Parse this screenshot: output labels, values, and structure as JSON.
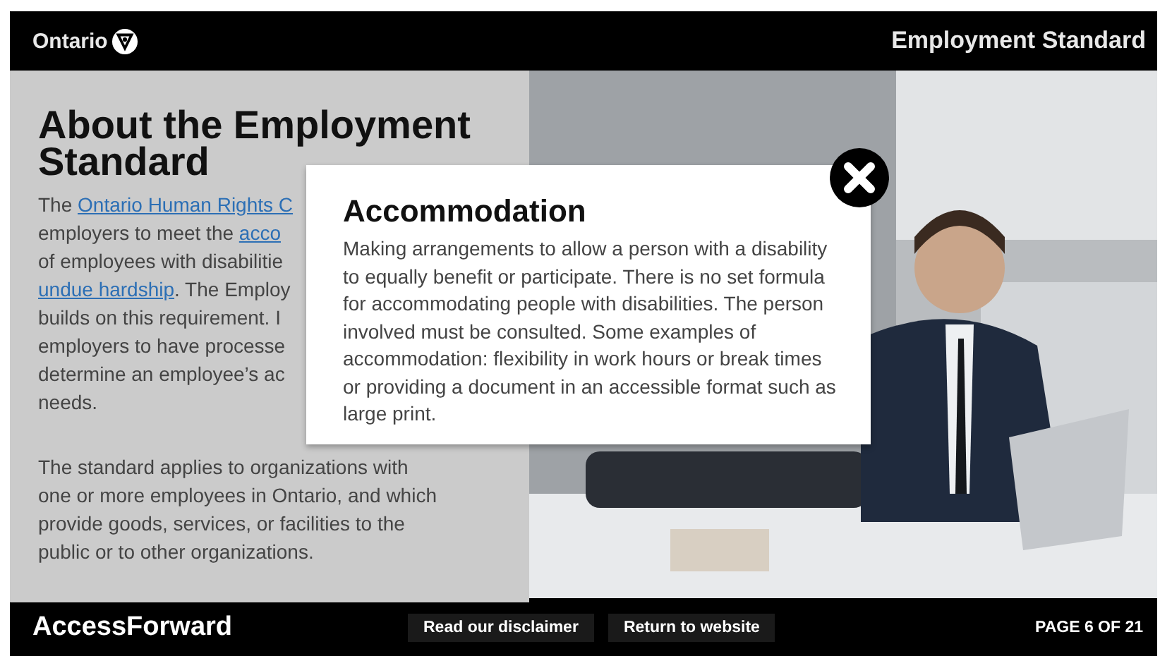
{
  "header": {
    "brand": "Ontario",
    "title": "Employment Standard"
  },
  "article": {
    "heading": "About the Employment Standard",
    "paragraphs": [
      [
        [
          {
            "text": "The ",
            "link": false
          },
          {
            "text": "Ontario Human Rights C",
            "link": true
          }
        ],
        [
          {
            "text": "employers to meet the ",
            "link": false
          },
          {
            "text": "acco",
            "link": true
          }
        ],
        [
          {
            "text": "of employees with disabilitie",
            "link": false
          }
        ],
        [
          {
            "text": "undue hardship",
            "link": true
          },
          {
            "text": ". The Employ",
            "link": false
          }
        ],
        [
          {
            "text": "builds on this requirement. I",
            "link": false
          }
        ],
        [
          {
            "text": "employers to have processe",
            "link": false
          }
        ],
        [
          {
            "text": "determine an employee’s ac",
            "link": false
          }
        ],
        [
          {
            "text": "needs.",
            "link": false
          }
        ]
      ],
      [
        [
          {
            "text": "The standard applies to organizations with",
            "link": false
          }
        ],
        [
          {
            "text": "one or more employees in Ontario, and which",
            "link": false
          }
        ],
        [
          {
            "text": "provide goods, services, or facilities to the",
            "link": false
          }
        ],
        [
          {
            "text": "public or to other organizations.",
            "link": false
          }
        ]
      ]
    ]
  },
  "modal": {
    "title": "Accommodation",
    "text": "Making arrangements to allow a person with a disability to equally benefit or participate. There is no set formula for accommodating people with disabilities. The person involved must be consulted. Some examples of accommodation: flexibility in work hours or break times or providing a document in an accessible format such as large print."
  },
  "footer": {
    "brand": "AccessForward",
    "buttons": [
      "Read our disclaimer",
      "Return to website"
    ],
    "page": "PAGE 6 OF 21"
  }
}
